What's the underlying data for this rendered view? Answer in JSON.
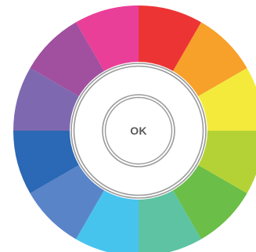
{
  "color_wheel": {
    "ok_label": "OK",
    "segments": [
      {
        "name": "red",
        "color": "#ed3434"
      },
      {
        "name": "orange",
        "color": "#f7a12a"
      },
      {
        "name": "yellow",
        "color": "#f3ea3c"
      },
      {
        "name": "yellow-green",
        "color": "#b4d236"
      },
      {
        "name": "green",
        "color": "#6bbe48"
      },
      {
        "name": "teal",
        "color": "#5dc3a2"
      },
      {
        "name": "sky-blue",
        "color": "#47c4ee"
      },
      {
        "name": "cornflower-blue",
        "color": "#5a84c8"
      },
      {
        "name": "blue",
        "color": "#2b68b5"
      },
      {
        "name": "violet",
        "color": "#7e69b0"
      },
      {
        "name": "purple",
        "color": "#a0509f"
      },
      {
        "name": "magenta",
        "color": "#e93f98"
      }
    ]
  }
}
